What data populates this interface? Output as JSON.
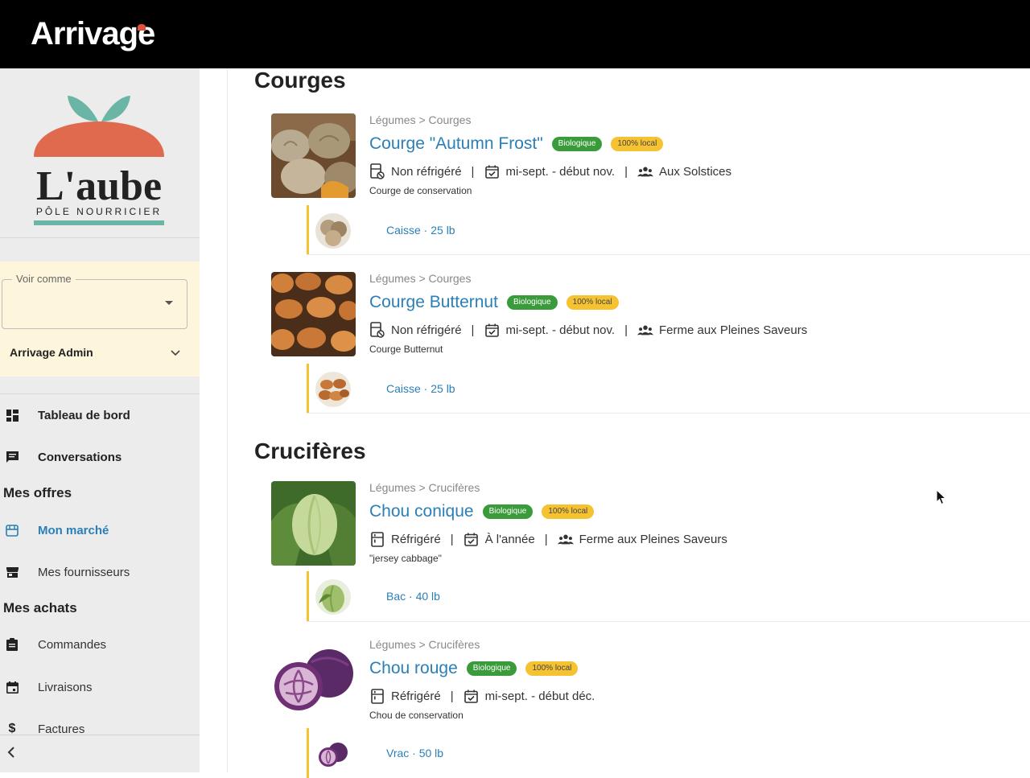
{
  "app": {
    "brand": "Arrivage"
  },
  "sidebar": {
    "org_logo": {
      "name": "L'aube",
      "subtitle": "PÔLE NOURRICIER"
    },
    "view_as": {
      "label": "Voir comme",
      "value": ""
    },
    "account": "Arrivage Admin",
    "nav": {
      "dashboard": "Tableau de bord",
      "conversations": "Conversations",
      "offers_title": "Mes offres",
      "market": "Mon marché",
      "suppliers": "Mes fournisseurs",
      "purchases_title": "Mes achats",
      "orders": "Commandes",
      "deliveries": "Livraisons",
      "invoices": "Factures"
    }
  },
  "categories": [
    {
      "title": "Courges",
      "products": [
        {
          "breadcrumb": "Légumes > Courges",
          "name": "Courge \"Autumn Frost\"",
          "badges": [
            "Biologique",
            "100% local"
          ],
          "storage": "Non réfrigéré",
          "season": "mi-sept. - début nov.",
          "producer": "Aux Solstices",
          "description": "Courge de conservation",
          "variant": "Caisse · 25 lb"
        },
        {
          "breadcrumb": "Légumes > Courges",
          "name": "Courge Butternut",
          "badges": [
            "Biologique",
            "100% local"
          ],
          "storage": "Non réfrigéré",
          "season": "mi-sept. - début nov.",
          "producer": "Ferme aux Pleines Saveurs",
          "description": "Courge Butternut",
          "variant": "Caisse · 25 lb"
        }
      ]
    },
    {
      "title": "Crucifères",
      "products": [
        {
          "breadcrumb": "Légumes > Crucifères",
          "name": "Chou conique",
          "badges": [
            "Biologique",
            "100% local"
          ],
          "storage": "Réfrigéré",
          "season": "À l'année",
          "producer": "Ferme aux Pleines Saveurs",
          "description": "\"jersey cabbage\"",
          "variant": "Bac · 40 lb"
        },
        {
          "breadcrumb": "Légumes > Crucifères",
          "name": "Chou rouge",
          "badges": [
            "Biologique",
            "100% local"
          ],
          "storage": "Réfrigéré",
          "season": "mi-sept. - début déc.",
          "description": "Chou de conservation",
          "variant": "Vrac · 50 lb"
        }
      ]
    }
  ],
  "colors": {
    "accent": "#2a7fb6",
    "bio": "#3a9b3a",
    "local": "#f5c232",
    "highlight": "#fdf5dc"
  }
}
